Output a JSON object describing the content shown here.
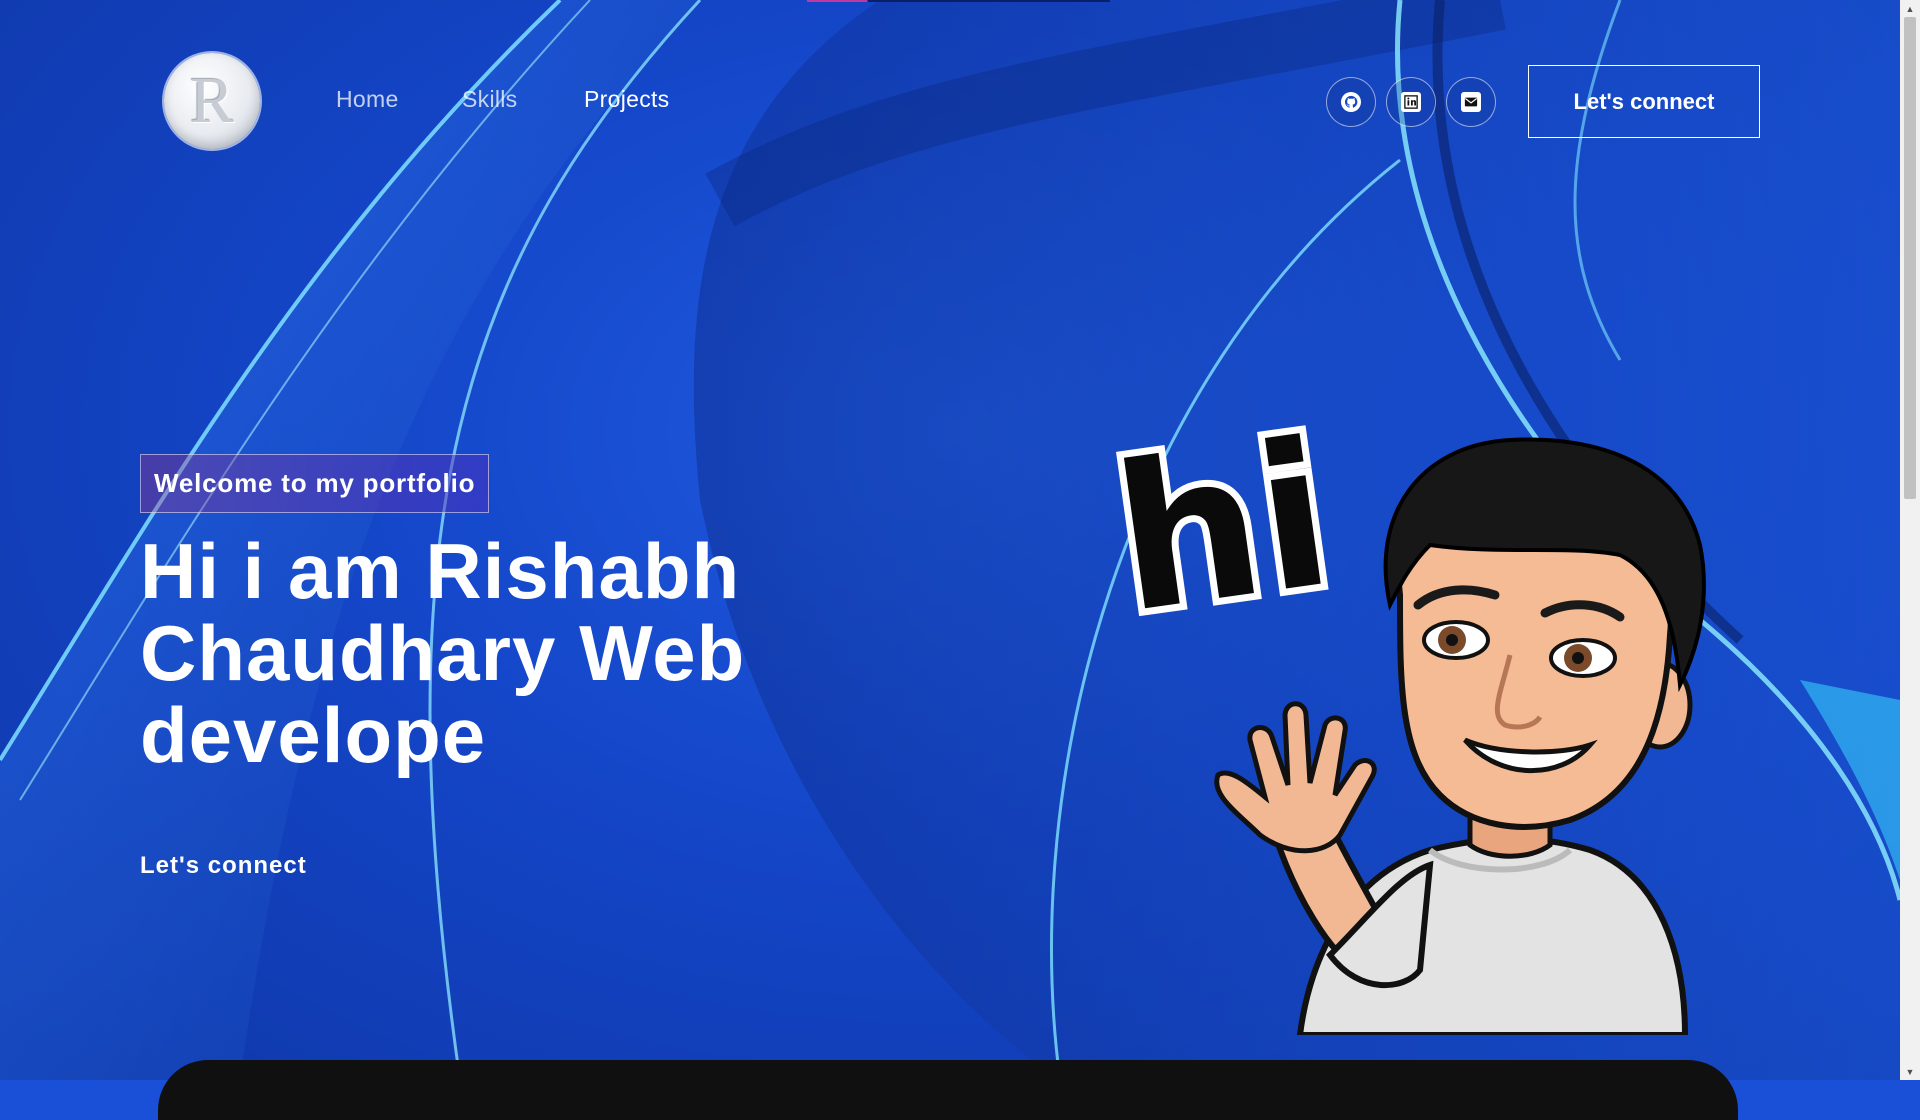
{
  "brand": {
    "logo_letter": "R"
  },
  "nav": {
    "links": [
      {
        "label": "Home"
      },
      {
        "label": "Skills"
      },
      {
        "label": "Projects"
      }
    ],
    "social_icons": [
      "github-icon",
      "linkedin-icon",
      "mail-icon"
    ],
    "connect_label": "Let's connect"
  },
  "hero": {
    "tagline": "Welcome to my portfolio",
    "title": "Hi i am Rishabh Chaudhary Web develope",
    "connect_label": "Let's connect",
    "sticker_text": "hi"
  },
  "colors": {
    "background": "#1446c8",
    "text": "#ffffff",
    "tagline_gradient_start": "#aa367c",
    "tagline_gradient_end": "#4a2fbd"
  }
}
